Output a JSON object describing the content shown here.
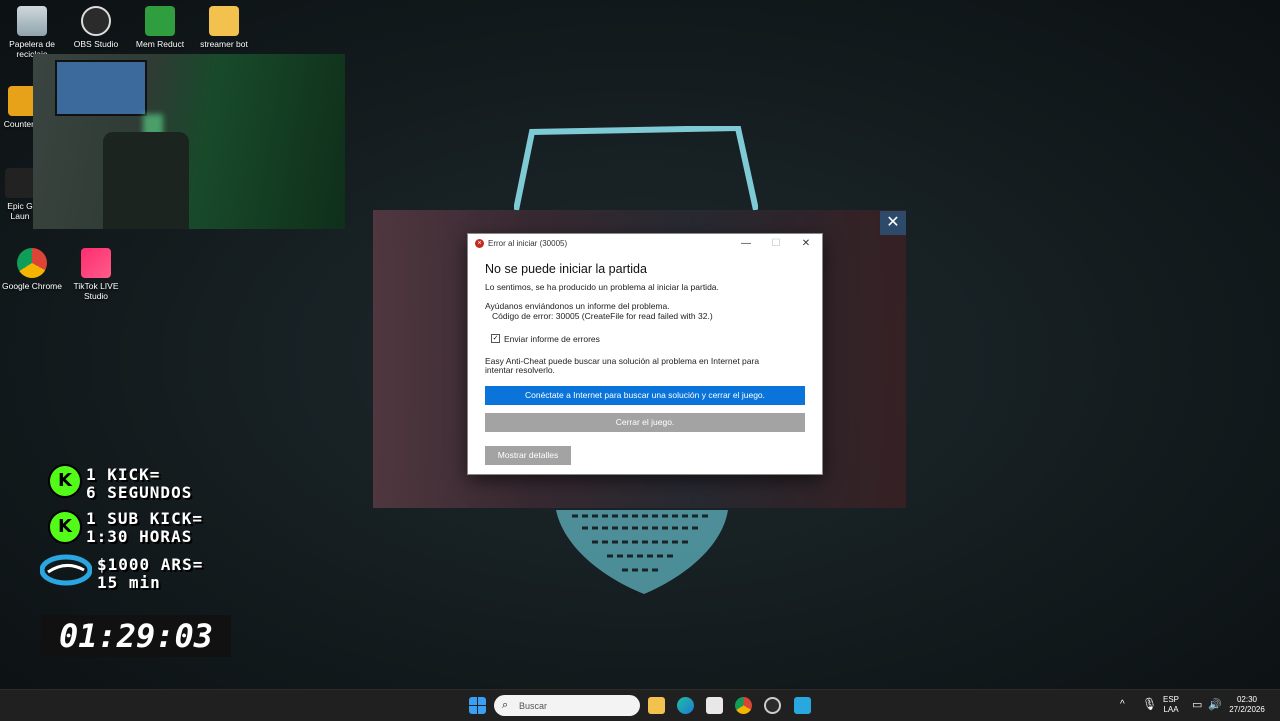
{
  "desktop": {
    "icons": [
      {
        "label": "Papelera de\nreciclaje",
        "icon": "recycle-bin-icon"
      },
      {
        "label": "OBS Studio",
        "icon": "obs-icon"
      },
      {
        "label": "Mem Reduct",
        "icon": "mem-reduct-icon"
      },
      {
        "label": "streamer bot",
        "icon": "folder-icon"
      },
      {
        "label": "Counter",
        "icon": "counter-strike-icon"
      },
      {
        "label": "Epic G\nLaun",
        "icon": "epic-games-icon"
      },
      {
        "label": "Google Chrome",
        "icon": "chrome-icon"
      },
      {
        "label": "TikTok LIVE\nStudio",
        "icon": "tiktok-icon"
      }
    ]
  },
  "dialog": {
    "title": "Error al iniciar (30005)",
    "minimize": "—",
    "maximize": "☐",
    "close": "✕",
    "heading": "No se puede iniciar la partida",
    "sorry": "Lo sentimos, se ha producido un problema al iniciar la partida.",
    "help": "Ayúdanos enviándonos un informe del problema.",
    "error_code": "Código de error: 30005 (CreateFile for read failed with 32.)",
    "send_report_checked": "✓",
    "send_report_label": "Enviar informe de errores",
    "eac_line1": "Easy Anti-Cheat puede buscar una solución al problema en Internet para",
    "eac_line2": "intentar resolverlo.",
    "connect_button": "Conéctate a Internet para buscar una solución y cerrar el juego.",
    "close_game_button": "Cerrar el juego.",
    "details_button": "Mostrar detalles"
  },
  "game_close": "✕",
  "overlay": {
    "kick_line1": "1 KICK=",
    "kick_line2": "6 SEGUNDOS",
    "subkick_line1": "1 SUB KICK=",
    "subkick_line2": "1:30 HORAS",
    "donation_line1": "$1000 ARS=",
    "donation_line2": "15 min",
    "kick_badge": "K",
    "timer": "01:29:03"
  },
  "taskbar": {
    "search_placeholder": "Buscar",
    "lang_top": "ESP",
    "lang_bottom": "LAA",
    "time": "02:30",
    "date": "27/2/2026",
    "chevron": "^"
  },
  "colors": {
    "dialog_primary": "#0a74da",
    "kick_green": "#53fc18",
    "shield_cyan": "#7ecbd6"
  }
}
